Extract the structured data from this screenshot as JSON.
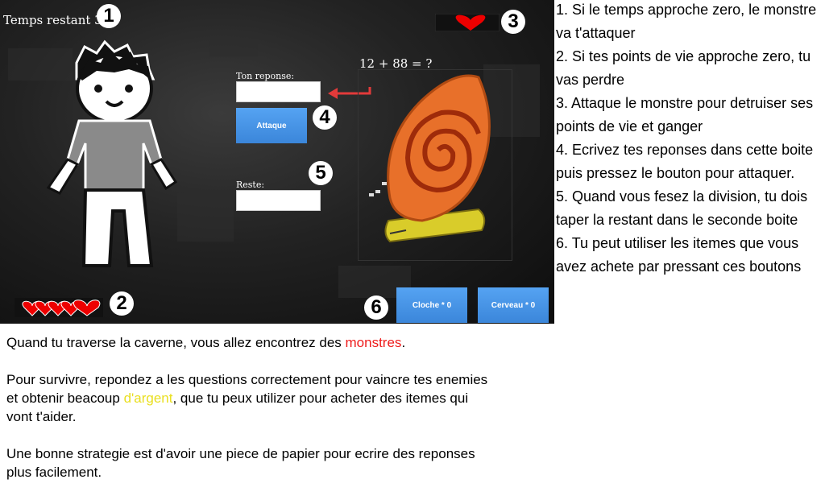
{
  "game": {
    "timer_label": "Temps restant 30",
    "answer_label": "Ton reponse:",
    "answer_value": "",
    "remainder_label": "Reste:",
    "remainder_value": "",
    "attack_button": "Attaque",
    "question": "12 + 88 = ?",
    "items": [
      {
        "label": "Cloche * 0"
      },
      {
        "label": "Cerveau * 0"
      }
    ],
    "markers": [
      "1",
      "2",
      "3",
      "4",
      "5",
      "6"
    ],
    "colors": {
      "heart": "#ff0000",
      "button": "#4a96e6",
      "snail_shell": "#e8702a",
      "snail_body": "#d9cc2a"
    }
  },
  "caption": {
    "p1_before": "Quand tu traverse la caverne, vous allez encontrez des ",
    "p1_highlight": "monstres",
    "p1_after": ".",
    "p2_before": "Pour survivre, repondez a les questions correctement pour vaincre tes enemies et obtenir beacoup ",
    "p2_highlight": "d'argent",
    "p2_after": ", que tu peux utilizer pour acheter des itemes qui vont t'aider.",
    "p3": "Une bonne strategie est d'avoir une piece de papier pour ecrire des reponses plus facilement."
  },
  "legend": [
    "1. Si le temps approche zero, le monstre va t'attaquer",
    "2. Si tes points de vie approche zero, tu vas perdre",
    "3. Attaque le monstre pour detruiser ses points de vie et ganger",
    "4. Ecrivez tes reponses dans cette boite puis pressez le bouton pour attaquer.",
    "5. Quand vous fesez la division, tu dois taper la restant dans le seconde boite",
    "6. Tu peut utiliser les itemes que vous avez achete par pressant ces boutons"
  ]
}
